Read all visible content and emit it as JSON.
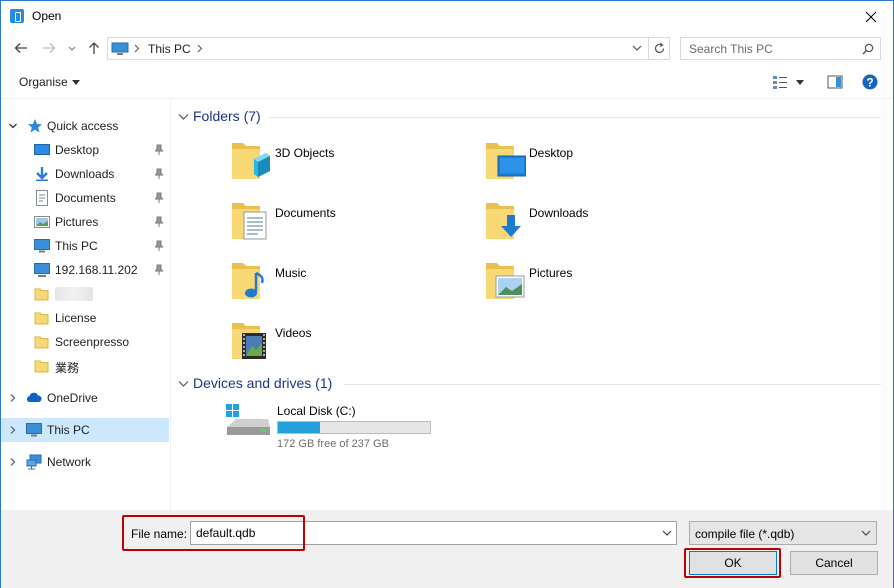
{
  "window": {
    "title": "Open"
  },
  "address_bar": {
    "crumb": "This PC"
  },
  "search": {
    "placeholder": "Search This PC"
  },
  "toolbar": {
    "organise_label": "Organise"
  },
  "nav_pane": {
    "quick_access_label": "Quick access",
    "quick_items": [
      {
        "label": "Desktop",
        "icon": "desktop-icon",
        "pinned": true
      },
      {
        "label": "Downloads",
        "icon": "downloads-icon",
        "pinned": true
      },
      {
        "label": "Documents",
        "icon": "documents-icon",
        "pinned": true
      },
      {
        "label": "Pictures",
        "icon": "pictures-icon",
        "pinned": true
      },
      {
        "label": "This PC",
        "icon": "this-pc-icon",
        "pinned": true
      },
      {
        "label": "192.168.11.202",
        "icon": "network-drive-icon",
        "pinned": true
      },
      {
        "label": "",
        "icon": "folder-icon",
        "pinned": false
      },
      {
        "label": "License",
        "icon": "folder-icon",
        "pinned": false
      },
      {
        "label": "Screenpresso",
        "icon": "folder-icon",
        "pinned": false
      },
      {
        "label": "業務",
        "icon": "folder-icon",
        "pinned": false
      }
    ],
    "onedrive_label": "OneDrive",
    "thispc_label": "This PC",
    "network_label": "Network"
  },
  "content": {
    "folders_header": "Folders (7)",
    "folders": [
      {
        "name": "3D Objects",
        "icon": "3d-objects-folder-icon"
      },
      {
        "name": "Desktop",
        "icon": "desktop-folder-icon"
      },
      {
        "name": "Documents",
        "icon": "documents-folder-icon"
      },
      {
        "name": "Downloads",
        "icon": "downloads-folder-icon"
      },
      {
        "name": "Music",
        "icon": "music-folder-icon"
      },
      {
        "name": "Pictures",
        "icon": "pictures-folder-icon"
      },
      {
        "name": "Videos",
        "icon": "videos-folder-icon"
      }
    ],
    "devices_header": "Devices and drives (1)",
    "drive": {
      "name": "Local Disk (C:)",
      "free_text": "172 GB free of 237 GB",
      "used_fraction": 0.274
    }
  },
  "bottom": {
    "file_name_label": "File name:",
    "file_name_value": "default.qdb",
    "file_type_value": "compile file (*.qdb)",
    "ok_label": "OK",
    "cancel_label": "Cancel"
  },
  "colors": {
    "accent": "#0078d7",
    "selection": "#cce8ff",
    "group_header": "#1e3287",
    "highlight_box": "#c00000",
    "folder_yellow": "#f8d775",
    "drive_fill": "#26a0da"
  }
}
